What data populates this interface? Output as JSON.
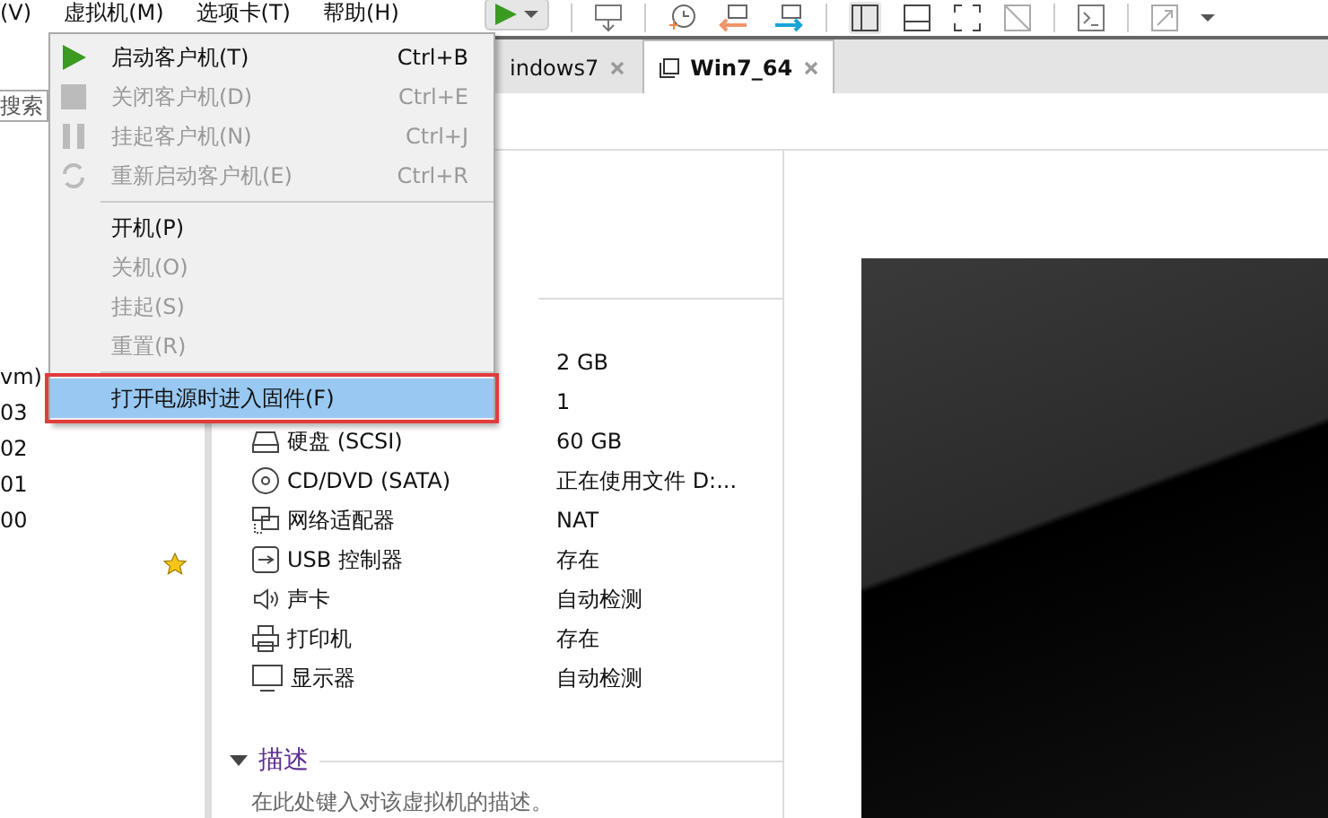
{
  "menubar": [
    "(V)",
    "虚拟机(M)",
    "选项卡(T)",
    "帮助(H)"
  ],
  "sidebar": {
    "search": {
      "placeholder": "搜索"
    },
    "items": [
      "vm)",
      "03",
      "02",
      "01",
      "00"
    ]
  },
  "tabs": [
    {
      "label": "indows7",
      "selected": false
    },
    {
      "label": "Win7_64",
      "selected": true
    }
  ],
  "hardware": [
    {
      "value": "2 GB"
    },
    {
      "value": "1"
    },
    {
      "label": "硬盘 (SCSI)",
      "value": "60 GB"
    },
    {
      "label": "CD/DVD (SATA)",
      "value": "正在使用文件 D:..."
    },
    {
      "label": "网络适配器",
      "value": "NAT"
    },
    {
      "label": "USB 控制器",
      "value": "存在"
    },
    {
      "label": "声卡",
      "value": "自动检测"
    },
    {
      "label": "打印机",
      "value": "存在"
    },
    {
      "label": "显示器",
      "value": "自动检测"
    }
  ],
  "description": {
    "title": "描述",
    "expanded": true,
    "placeholder": "在此处键入对该虚拟机的描述。"
  },
  "power_menu": [
    {
      "kind": "play",
      "label": "启动客户机(T)",
      "shortcut": "Ctrl+B",
      "disabled": false,
      "selected": false,
      "highlighted": false
    },
    {
      "kind": "stop",
      "label": "关闭客户机(D)",
      "shortcut": "Ctrl+E",
      "disabled": true,
      "selected": false,
      "highlighted": false
    },
    {
      "kind": "pause",
      "label": "挂起客户机(N)",
      "shortcut": "Ctrl+J",
      "disabled": true,
      "selected": false,
      "highlighted": false
    },
    {
      "kind": "restart",
      "label": "重新启动客户机(E)",
      "shortcut": "Ctrl+R",
      "disabled": true,
      "selected": false,
      "highlighted": false
    },
    {
      "kind": "separator"
    },
    {
      "kind": "plain",
      "label": "开机(P)",
      "disabled": false,
      "selected": false,
      "highlighted": false
    },
    {
      "kind": "plain",
      "label": "关机(O)",
      "disabled": true,
      "selected": false,
      "highlighted": false
    },
    {
      "kind": "plain",
      "label": "挂起(S)",
      "disabled": true,
      "selected": false,
      "highlighted": false
    },
    {
      "kind": "plain",
      "label": "重置(R)",
      "disabled": true,
      "selected": false,
      "highlighted": false
    },
    {
      "kind": "separator"
    },
    {
      "kind": "plain",
      "label": "打开电源时进入固件(F)",
      "disabled": false,
      "selected": true,
      "highlighted": true
    }
  ]
}
